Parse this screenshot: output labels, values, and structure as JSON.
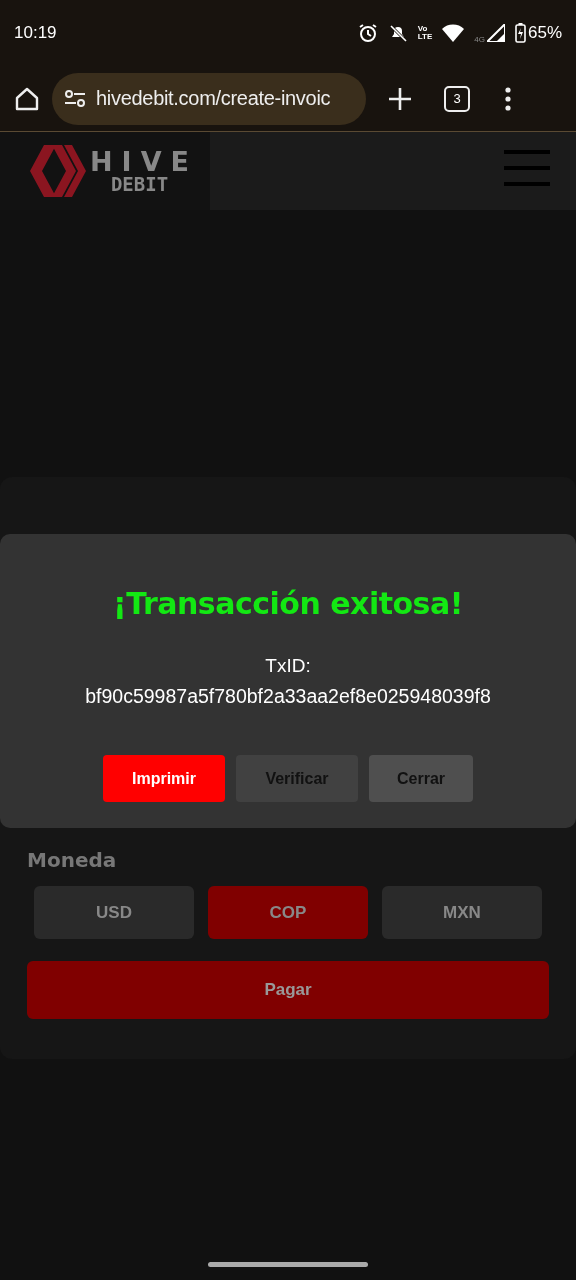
{
  "status_bar": {
    "time": "10:19",
    "volte": [
      "Vo",
      "LTE"
    ],
    "network": "4G",
    "battery": "65%"
  },
  "browser": {
    "url": "hivedebit.com/create-invoic",
    "tab_count": "3"
  },
  "site_header": {
    "logo_top": "HIVE",
    "logo_bottom": "DEBIT"
  },
  "dialog": {
    "title": "¡Transacción exitosa!",
    "txid_label": "TxID:",
    "txid": "bf90c59987a5f780bf2a33aa2ef8e025948039f8",
    "buttons": [
      {
        "label": "Imprimir",
        "kind": "primary"
      },
      {
        "label": "Verificar",
        "kind": "secondary"
      },
      {
        "label": "Cerrar",
        "kind": "tertiary"
      }
    ]
  },
  "form": {
    "currency_label": "Moneda",
    "currencies": [
      {
        "label": "USD",
        "selected": false
      },
      {
        "label": "COP",
        "selected": true
      },
      {
        "label": "MXN",
        "selected": false
      }
    ],
    "pay_button": "Pagar"
  }
}
